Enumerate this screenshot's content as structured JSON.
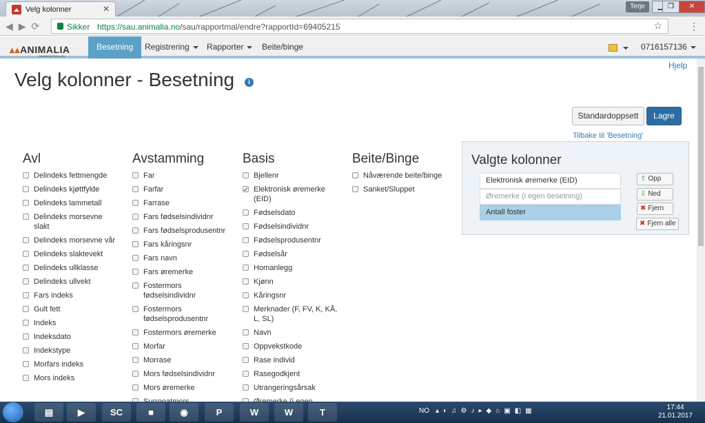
{
  "browser": {
    "tab_title": "Velg kolonner",
    "tab_close": "✕",
    "user": "Terje",
    "secure_label": "Sikker",
    "url_host": "https://sau.animalia.no",
    "url_path": "/sau/rapportmal/endre?rapportId=69405215"
  },
  "app": {
    "logo": "ANIMALIA",
    "logo_sub": "SAUEKONTROLLEN",
    "nav": [
      {
        "label": "Besetning"
      },
      {
        "label": "Registrering"
      },
      {
        "label": "Rapporter"
      },
      {
        "label": "Beite/binge"
      }
    ],
    "account": "0716157136"
  },
  "page": {
    "help": "Hjelp",
    "title": "Velg kolonner - Besetning",
    "btn_default": "Standardoppsett",
    "btn_save": "Lagre",
    "back_link": "Tilbake til 'Besetning'"
  },
  "columns": {
    "avl": {
      "heading": "Avl",
      "items": [
        "Delindeks fettmengde",
        "Delindeks kjøttfylde",
        "Delindeks lammetall",
        "Delindeks morsevne slakt",
        "Delindeks morsevne vår",
        "Delindeks slaktevekt",
        "Delindeks ullklasse",
        "Delindeks ullvekt",
        "Fars indeks",
        "Gult fett",
        "Indeks",
        "Indeksdato",
        "Indekstype",
        "Morfars indeks",
        "Mors indeks"
      ]
    },
    "avstamming": {
      "heading": "Avstamming",
      "items": [
        "Far",
        "Farfar",
        "Farrase",
        "Fars fødselsindividnr",
        "Fars fødselsprodusentnr",
        "Fars kåringsnr",
        "Fars navn",
        "Fars øremerke",
        "Fostermors fødselsindividnr",
        "Fostermors fødselsprodusentnr",
        "Fostermors øremerke",
        "Morfar",
        "Morrase",
        "Mors fødselsindividnr",
        "Mors øremerke",
        "Surrogatmors"
      ]
    },
    "basis": {
      "heading": "Basis",
      "items": [
        "Bjellenr",
        "Elektronisk øremerke (EID)",
        "Fødselsdato",
        "Fødselsindividnr",
        "Fødselsprodusentnr",
        "Fødselsår",
        "Homanlegg",
        "Kjønn",
        "Kåringsnr",
        "Merknader (F, FV, K, KÅ, L, SL)",
        "Navn",
        "Oppvekstkode",
        "Rase individ",
        "Rasegodkjent",
        "Utrangeringsårsak",
        "Øremerke (i egen"
      ]
    },
    "beite": {
      "heading": "Beite/Binge",
      "items": [
        "Nåværende beite/binge",
        "Sanket/Sluppet"
      ]
    }
  },
  "selected": {
    "heading": "Valgte kolonner",
    "items": [
      "Elektronisk øremerke (EID)",
      "Øremerke (i egen besetning)",
      "Antall foster"
    ],
    "btn_up": "Opp",
    "btn_down": "Ned",
    "btn_remove": "Fjern",
    "btn_remove_all": "Fjern alle"
  },
  "taskbar": {
    "lang": "NO",
    "time": "17:44",
    "date": "21.01.2017"
  },
  "colors": {
    "accent": "#5ba0c7",
    "primary": "#2e6da4"
  }
}
